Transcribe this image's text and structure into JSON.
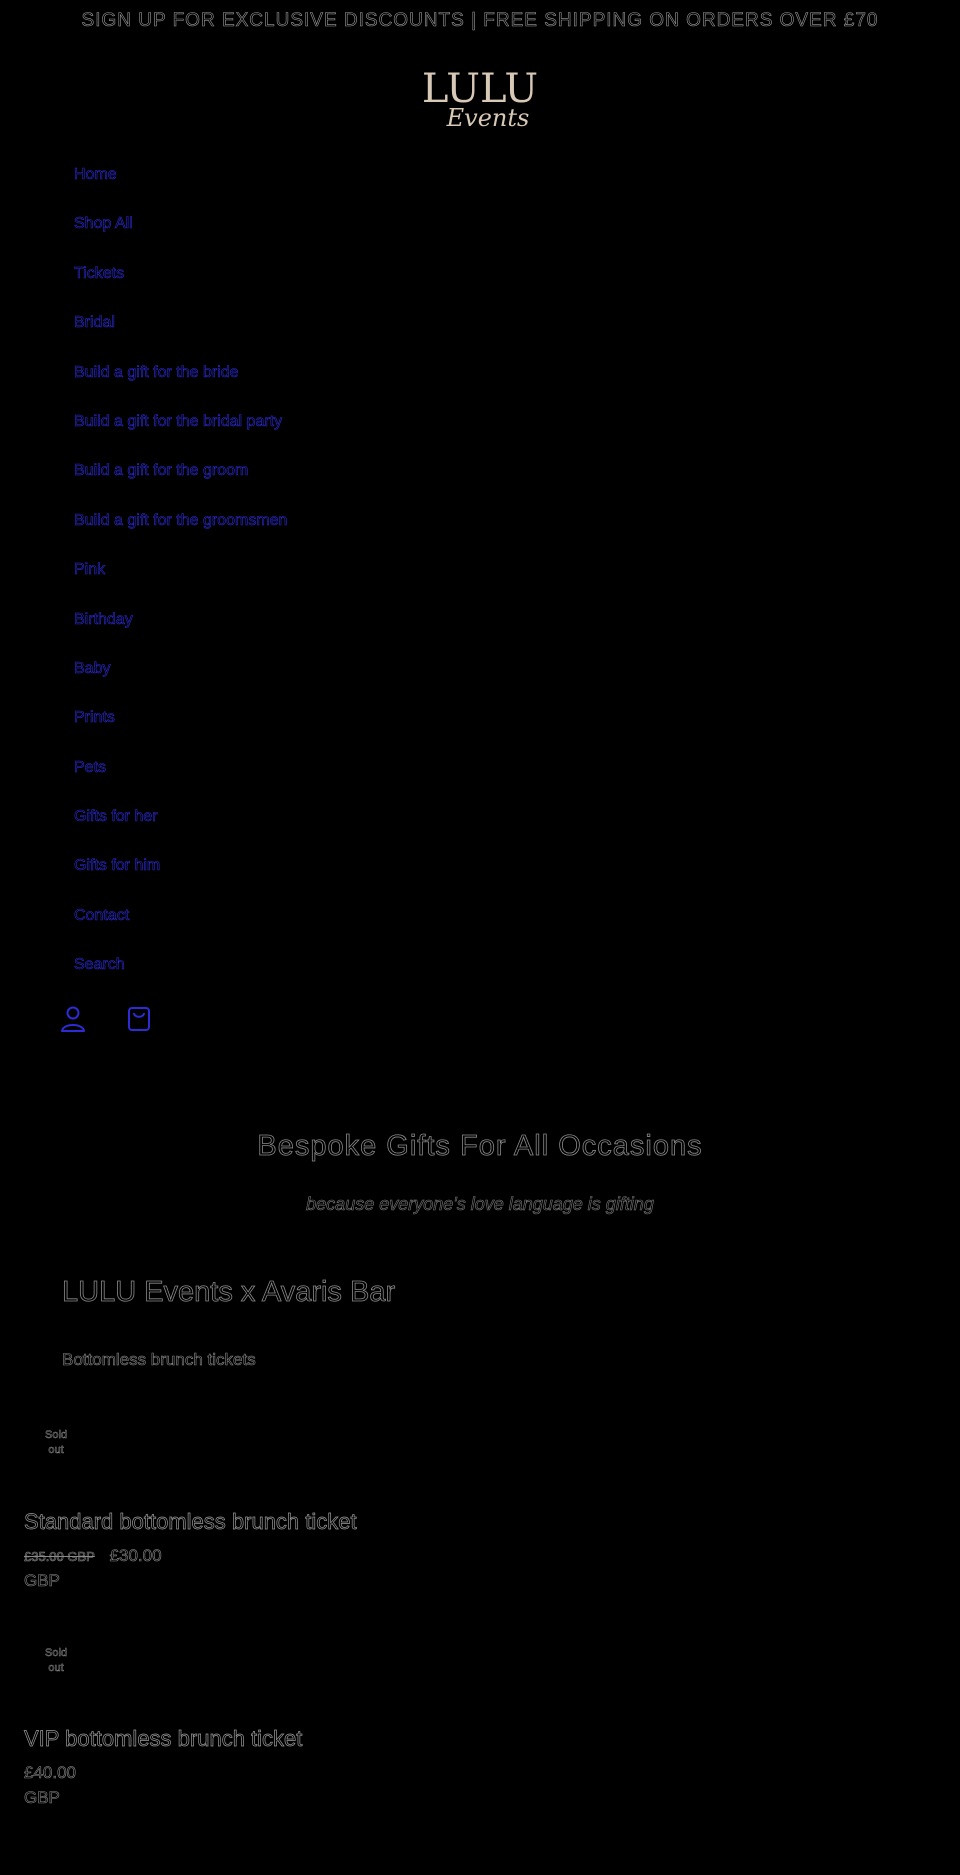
{
  "announcement": "SIGN UP FOR EXCLUSIVE DISCOUNTS | FREE SHIPPING ON ORDERS OVER £70",
  "logo": {
    "text_main": "LULU",
    "text_script": "Events",
    "color": "#d8c9b6"
  },
  "nav": {
    "items": [
      "Home",
      "Shop All",
      "Tickets",
      "Bridal",
      "Build a gift for the bride",
      "Build a gift for the bridal party",
      "Build a gift for the groom",
      "Build a gift for the groomsmen",
      "Pink",
      "Birthday",
      "Baby",
      "Prints",
      "Pets",
      "Gifts for her",
      "Gifts for him",
      "Contact",
      "Search"
    ],
    "link_color": "#2d2bd6"
  },
  "header_icons": {
    "account": "account-icon",
    "cart": "cart-icon"
  },
  "hero": {
    "title": "Bespoke Gifts For All Occasions",
    "subtitle": "because everyone's love language is gifting"
  },
  "collection": {
    "title": "LULU Events x Avaris Bar",
    "description": "Bottomless brunch tickets"
  },
  "products": [
    {
      "badge": "Sold out",
      "title": "Standard bottomless brunch ticket",
      "compare_price": "£35.00 GBP",
      "price": "£30.00",
      "currency": "GBP"
    },
    {
      "badge": "Sold out",
      "title": "VIP bottomless brunch ticket",
      "compare_price": "",
      "price": "£40.00",
      "currency": "GBP"
    }
  ]
}
